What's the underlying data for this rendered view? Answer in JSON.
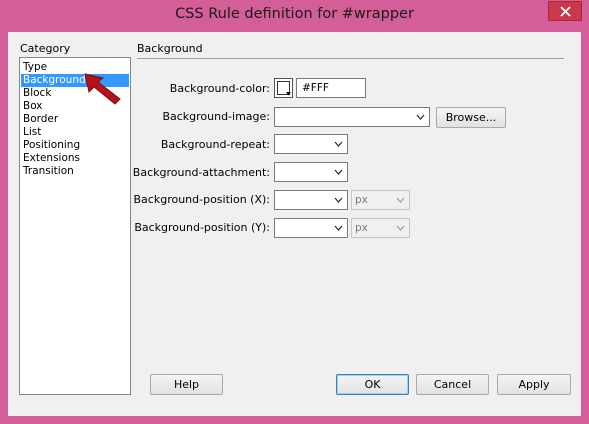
{
  "window": {
    "title": "CSS Rule definition for #wrapper"
  },
  "category": {
    "title": "Category",
    "items": [
      "Type",
      "Background",
      "Block",
      "Box",
      "Border",
      "List",
      "Positioning",
      "Extensions",
      "Transition"
    ],
    "selected": "Background"
  },
  "section": {
    "title": "Background"
  },
  "fields": {
    "color": {
      "label": "Background-color:",
      "value": "#FFF"
    },
    "image": {
      "label": "Background-image:",
      "value": "",
      "browse_label": "Browse..."
    },
    "repeat": {
      "label": "Background-repeat:",
      "value": ""
    },
    "attachment": {
      "label": "Background-attachment:",
      "value": ""
    },
    "position_x": {
      "label": "Background-position (X):",
      "value": "",
      "unit": "px"
    },
    "position_y": {
      "label": "Background-position (Y):",
      "value": "",
      "unit": "px"
    }
  },
  "buttons": {
    "help": "Help",
    "ok": "OK",
    "cancel": "Cancel",
    "apply": "Apply"
  },
  "colors": {
    "frame": "#d45e98",
    "selection": "#3399ff",
    "close_button": "#c9394b",
    "pointer": "#b3121b"
  },
  "icons": {
    "close": "close-icon",
    "dropdown": "chevron-down-icon",
    "pointer": "red-arrow-pointer"
  }
}
